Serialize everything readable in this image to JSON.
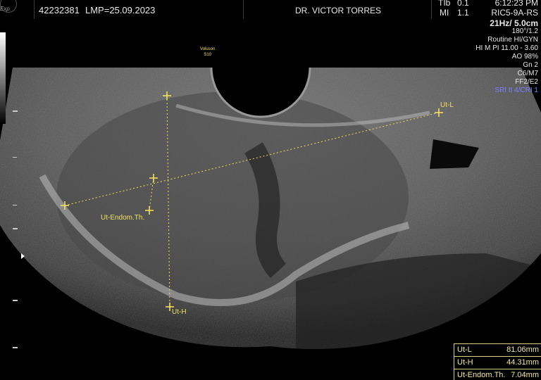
{
  "header": {
    "logo_sub": "Exp",
    "patient_id": "42232381",
    "lmp": "LMP=25.09.2023",
    "doctor": "DR. VICTOR TORRES",
    "tib_label": "TIb",
    "tib_value": "0.1",
    "mi_label": "MI",
    "mi_value": "1.1",
    "time": "6:12:23 PM",
    "probe": "RIC5-9A-RS"
  },
  "settings": {
    "frequency_depth": "21Hz/ 5.0cm",
    "angle": "180°/1.2",
    "preset": "Routine HI/GYN",
    "harmonic": "HI M PI 11.00 - 3.60",
    "ao": "AO 98%",
    "gain": "Gn  2",
    "c_m": "C6/M7",
    "ff_e": "FF2/E2",
    "sri_cri": "SRI II 4/CRI 1"
  },
  "system_badge": {
    "line1": "Voluson",
    "line2": "S10"
  },
  "annotations": {
    "ut_l": "Ut-L",
    "ut_h": "Ut-H",
    "endom": "Ut-Endom.Th."
  },
  "measurements": [
    {
      "label": "Ut-L",
      "value": "81.06mm"
    },
    {
      "label": "Ut-H",
      "value": "44.31mm"
    },
    {
      "label": "Ut-Endom.Th.",
      "value": "7.04mm"
    }
  ],
  "colors": {
    "caliper": "#f0e060",
    "sri_text": "#8080ff"
  }
}
